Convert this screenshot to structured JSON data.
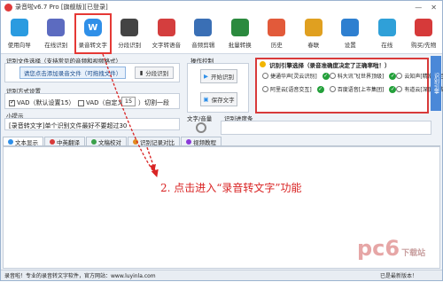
{
  "titlebar": {
    "title": "录音啦v6.7 Pro [旗舰版][已登录]",
    "minimize": "—",
    "close": "✕"
  },
  "toolbar": [
    {
      "name": "usage-guide",
      "label": "使用向导",
      "icon_color": "#2a9be0"
    },
    {
      "name": "online-recognize",
      "label": "在线识别",
      "icon_color": "#5c6bc0"
    },
    {
      "name": "audio-to-text",
      "label": "录音转文字",
      "icon_color": "#2f8fe8"
    },
    {
      "name": "segment-recognize",
      "label": "分段识别",
      "icon_color": "#444444"
    },
    {
      "name": "text-to-speech",
      "label": "文字转语音",
      "icon_color": "#d43e3e"
    },
    {
      "name": "audio-clip",
      "label": "音频剪辑",
      "icon_color": "#3a6fb5"
    },
    {
      "name": "batch-convert",
      "label": "批量转换",
      "icon_color": "#2b8a3e"
    },
    {
      "name": "history",
      "label": "历史",
      "icon_color": "#e25a3a"
    },
    {
      "name": "help",
      "label": "春联",
      "icon_color": "#e0a020"
    },
    {
      "name": "settings",
      "label": "设置",
      "icon_color": "#2e7fd0"
    },
    {
      "name": "online",
      "label": "在线",
      "icon_color": "#2fa0d8"
    },
    {
      "name": "buy",
      "label": "购买/先物",
      "icon_color": "#d63a3a"
    }
  ],
  "left_panel": {
    "file_section_label": "识别文件选择（支持常见的音频和视频格式）",
    "add_file_button": "请您点击添加录音文件（可拖拽文件）",
    "segment_button": "分段识别",
    "mode_section_label": "识别方式设置",
    "vad_default": "VAD（默认设置15）",
    "vad_custom": "VAD（自定义",
    "vad_value": "15",
    "vad_suffix": "）切割一段",
    "tip_label": "小提示",
    "tip_text": "[录音转文字]单个识别文件最好不要超过30"
  },
  "action_panel": {
    "label": "操作控制",
    "start_button": "开始识别",
    "save_button": "保存文字"
  },
  "engine_panel": {
    "header": "识别引擎选择（录音准确度决定了正确率啦！）",
    "engines": [
      {
        "label": "捷通华声[灵云识别]",
        "selected": false
      },
      {
        "label": "科大讯飞[世界顶级]",
        "selected": false
      },
      {
        "label": "云知声[精准稳定]",
        "selected": false
      },
      {
        "label": "阿里云[语音交互]",
        "selected": false
      },
      {
        "label": "百度语音[上市集团]",
        "selected": false
      },
      {
        "label": "有道云[深度算法]",
        "selected": false
      }
    ],
    "side_label": "识别引擎"
  },
  "text_panel": {
    "label": "文字/音量",
    "progress_label": "识别进度条"
  },
  "tabs": [
    {
      "label": "文本显示",
      "active": true
    },
    {
      "label": "中英翻译",
      "active": false
    },
    {
      "label": "文稿校对",
      "active": false
    },
    {
      "label": "识别记录对比",
      "active": false
    },
    {
      "label": "视频教程",
      "active": false
    }
  ],
  "annotation": "2.  点击进入“录音转文字”功能",
  "statusbar": {
    "left": "录音啦！专业的录音转文字软件，官方网站：www.luyinla.com",
    "right": "已是最新版本！"
  },
  "watermark": {
    "main": "pc6",
    "sub": "下载站"
  },
  "colors": {
    "accent": "#2f8fe8",
    "annotation": "#d92424",
    "ok": "#23a03a"
  }
}
